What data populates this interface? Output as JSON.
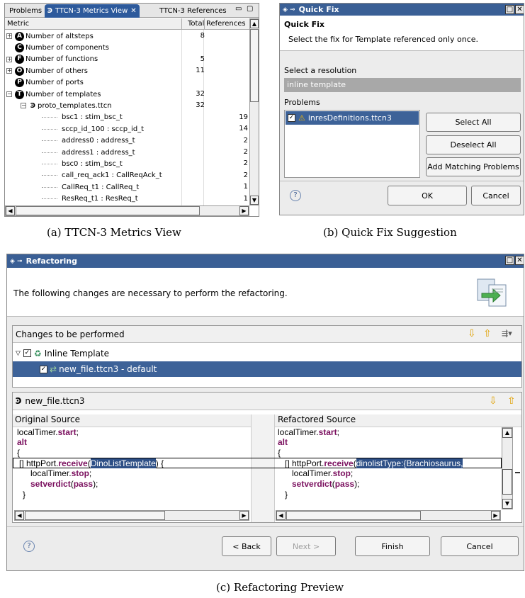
{
  "metrics_view": {
    "tabs": [
      "Problems",
      "TTCN-3 Metrics View",
      "TTCN-3 References"
    ],
    "columns": [
      "Metric",
      "Total",
      "References"
    ],
    "rows": [
      {
        "badge": "A",
        "label": "Number of altsteps",
        "total": "8",
        "refs": ""
      },
      {
        "badge": "C",
        "label": "Number of components",
        "total": "",
        "refs": ""
      },
      {
        "badge": "F",
        "label": "Number of functions",
        "total": "5",
        "refs": ""
      },
      {
        "badge": "O",
        "label": "Number of others",
        "total": "11",
        "refs": ""
      },
      {
        "badge": "P",
        "label": "Number of ports",
        "total": "",
        "refs": ""
      },
      {
        "badge": "T",
        "label": "Number of templates",
        "total": "32",
        "refs": ""
      },
      {
        "badge": "",
        "label": "proto_templates.ttcn",
        "total": "32",
        "refs": ""
      },
      {
        "badge": "",
        "label": "bsc1 : stim_bsc_t",
        "total": "",
        "refs": "19"
      },
      {
        "badge": "",
        "label": "sccp_id_100 : sccp_id_t",
        "total": "",
        "refs": "14"
      },
      {
        "badge": "",
        "label": "address0 : address_t",
        "total": "",
        "refs": "2"
      },
      {
        "badge": "",
        "label": "address1 : address_t",
        "total": "",
        "refs": "2"
      },
      {
        "badge": "",
        "label": "bsc0 : stim_bsc_t",
        "total": "",
        "refs": "2"
      },
      {
        "badge": "",
        "label": "call_req_ack1 : CallReqAck_t",
        "total": "",
        "refs": "2"
      },
      {
        "badge": "",
        "label": "CallReq_t1 : CallReq_t",
        "total": "",
        "refs": "1"
      },
      {
        "badge": "",
        "label": "ResReq_t1 : ResReq_t",
        "total": "",
        "refs": "1"
      }
    ]
  },
  "quick_fix": {
    "window_title": "Quick Fix",
    "heading": "Quick Fix",
    "description": "Select the fix for Template referenced only once.",
    "resolution_label": "Select a resolution",
    "resolution_value": "inline template",
    "problems_label": "Problems",
    "problem_item": "inresDefinitions.ttcn3",
    "select_all": "Select All",
    "deselect_all": "Deselect All",
    "add_matching": "Add Matching Problems",
    "ok": "OK",
    "cancel": "Cancel"
  },
  "refactoring": {
    "window_title": "Refactoring",
    "description": "The following changes are necessary to perform the refactoring.",
    "changes_header": "Changes to be performed",
    "tree_parent": "Inline Template",
    "tree_child": "new_file.ttcn3 - default",
    "file_header": "new_file.ttcn3",
    "original_header": "Original Source",
    "refactored_header": "Refactored Source",
    "original_code": {
      "l1_a": "localTimer.",
      "l1_b": "start",
      "l1_c": ";",
      "l2": "alt",
      "l3": "{",
      "l4_a": "[] httpPort.",
      "l4_b": "receive",
      "l4_c": "(",
      "l4_d": "DinoListTemplate",
      "l4_e": ") {",
      "l5_a": "localTimer.",
      "l5_b": "stop",
      "l5_c": ";",
      "l6_a": "setverdict",
      "l6_b": "(",
      "l6_c": "pass",
      "l6_d": ");",
      "l7": "}"
    },
    "refactored_code": {
      "l1_a": "localTimer.",
      "l1_b": "start",
      "l1_c": ";",
      "l2": "alt",
      "l3": "{",
      "l4_a": "[] httpPort.",
      "l4_b": "receive",
      "l4_c": "(",
      "l4_d": "dinolistType:{Brachiosaurus,",
      "l5_a": "localTimer.",
      "l5_b": "stop",
      "l5_c": ";",
      "l6_a": "setverdict",
      "l6_b": "(",
      "l6_c": "pass",
      "l6_d": ");",
      "l7": "}"
    },
    "back": "< Back",
    "next": "Next >",
    "finish": "Finish",
    "cancel": "Cancel"
  },
  "captions": {
    "a": "(a)  TTCN-3 Metrics View",
    "b": "(b)  Quick Fix Suggestion",
    "c": "(c)  Refactoring Preview"
  }
}
